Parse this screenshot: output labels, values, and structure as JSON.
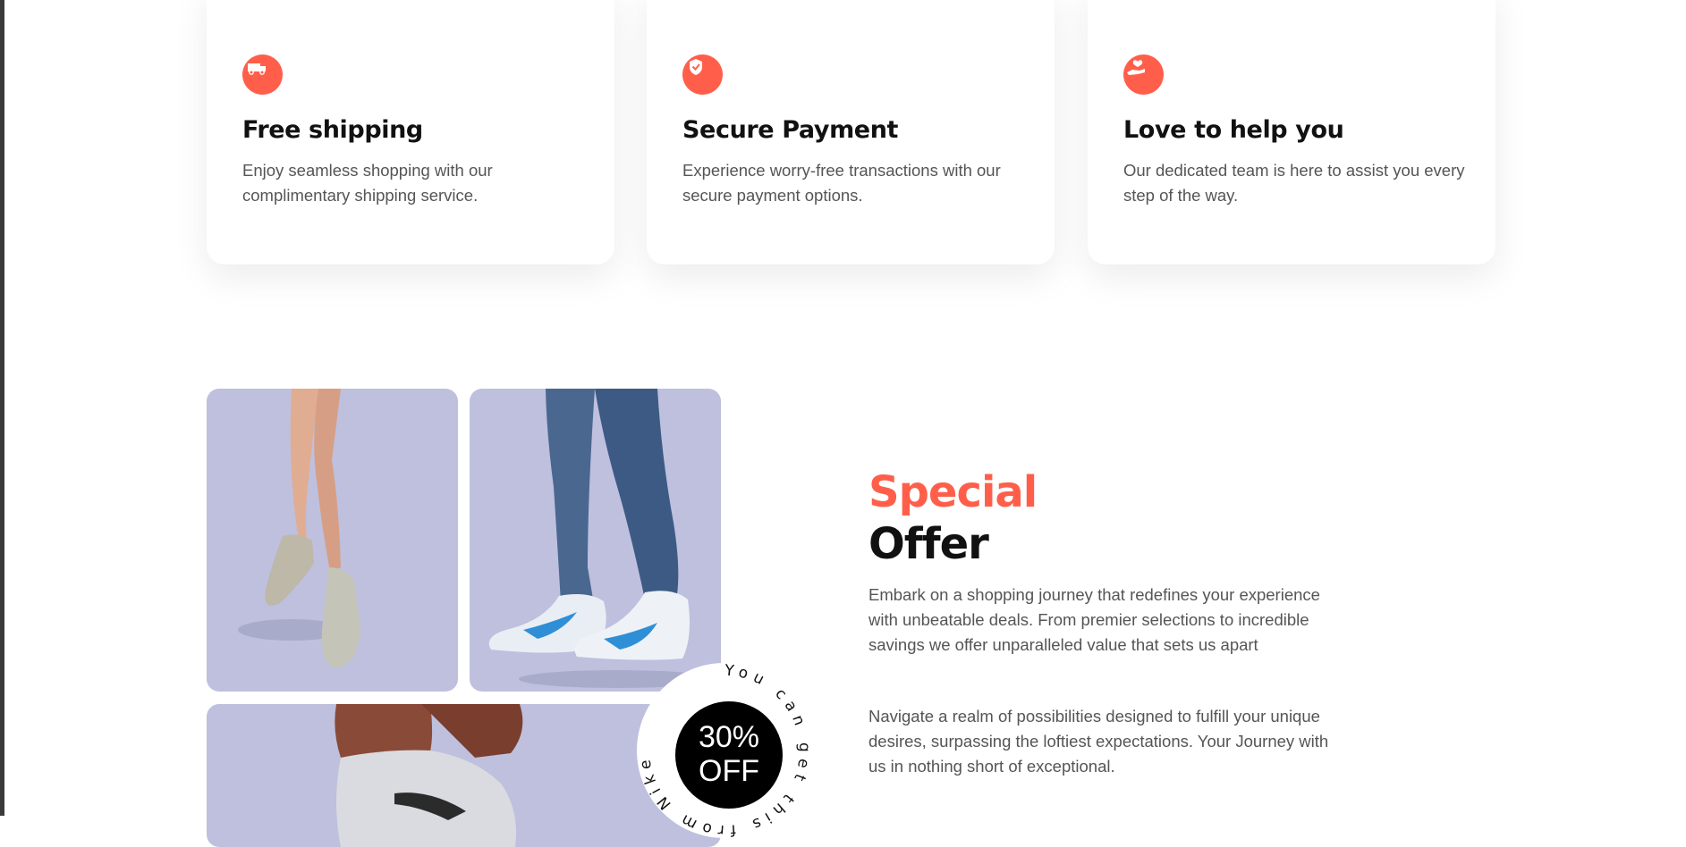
{
  "features": [
    {
      "icon": "truck-icon",
      "title": "Free shipping",
      "desc": "Enjoy seamless shopping with our complimentary shipping service."
    },
    {
      "icon": "shield-check-icon",
      "title": "Secure Payment",
      "desc": "Experience worry-free transactions with our secure payment options."
    },
    {
      "icon": "hand-heart-icon",
      "title": "Love to help you",
      "desc": "Our dedicated team is here to assist you every step of the way."
    }
  ],
  "colors": {
    "accent": "#ff5f4a",
    "photo_bg": "#bec0de",
    "text_dark": "#111111",
    "text_muted": "#555555"
  },
  "offer": {
    "title_accent": "Special",
    "title_rest": "Offer",
    "paragraph1": "Embark on a shopping journey that redefines your experience with unbeatable deals. From premier selections to incredible savings we offer unparalleled value that sets us apart",
    "paragraph2": "Navigate a realm of possibilities designed to fulfill your unique desires, surpassing the loftiest expectations. Your Journey with us in nothing short of exceptional."
  },
  "badge": {
    "line1": "30%",
    "line2": "OFF",
    "ring_text": "You can get this from Nike "
  }
}
